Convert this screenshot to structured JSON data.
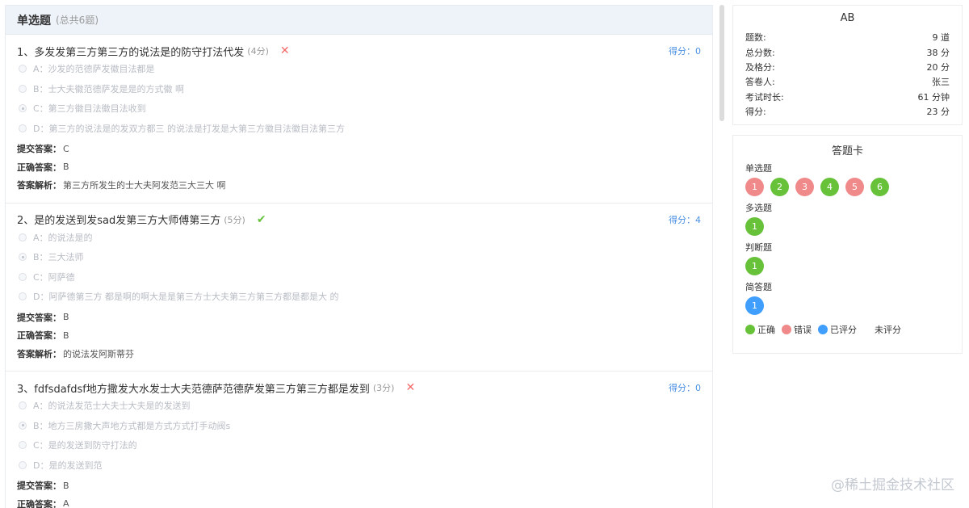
{
  "section": {
    "title": "单选题",
    "subtitle": "(总共6题)"
  },
  "questions": [
    {
      "title": "1、多发发第三方第三方的说法是的防守打法代发",
      "score_note": "(4分)",
      "result": "wrong",
      "result_icon": "cross-icon",
      "points": "得分：0",
      "options": [
        {
          "text": "A：沙发的范德萨发徽目法都是",
          "checked": false
        },
        {
          "text": "B：士大夫徽范德萨发是是的方式徽 啊",
          "checked": false
        },
        {
          "text": "C：第三方徽目法徽目法收到",
          "checked": true
        },
        {
          "text": "D：第三方的说法是的发双方都三 的说法是打发是大第三方徽目法徽目法第三方",
          "checked": false
        }
      ],
      "submitted_label": "提交答案：",
      "submitted": "C",
      "correct_label": "正确答案：",
      "correct": "B",
      "explain_label": "答案解析：",
      "explain": "第三方所发生的士大夫阿发范三大三大 啊"
    },
    {
      "title": "2、是的发送到发sad发第三方大师傅第三方",
      "score_note": "(5分)",
      "result": "right",
      "result_icon": "check-icon",
      "points": "得分：4",
      "options": [
        {
          "text": "A：的说法是的",
          "checked": false
        },
        {
          "text": "B：三大法师",
          "checked": true
        },
        {
          "text": "C：阿萨德",
          "checked": false
        },
        {
          "text": "D：阿萨德第三方 都是啊的啊大是是第三方士大夫第三方第三方都是都是大 的",
          "checked": false
        }
      ],
      "submitted_label": "提交答案：",
      "submitted": "B",
      "correct_label": "正确答案：",
      "correct": "B",
      "explain_label": "答案解析：",
      "explain": "的说法发阿斯蒂芬"
    },
    {
      "title": "3、fdfsdafdsf地方撒发大水发士大夫范德萨范德萨发第三方第三方都是发到",
      "score_note": "(3分)",
      "result": "wrong",
      "result_icon": "cross-icon",
      "points": "得分：0",
      "options": [
        {
          "text": "A：的说法发范士大夫士大夫是的发送到",
          "checked": false
        },
        {
          "text": "B：地方三房撒大声地方式都是方式方式打手动阀s",
          "checked": true
        },
        {
          "text": "C：是的发送到防守打法的",
          "checked": false
        },
        {
          "text": "D：是的发送到范",
          "checked": false
        }
      ],
      "submitted_label": "提交答案：",
      "submitted": "B",
      "correct_label": "正确答案：",
      "correct": "A"
    }
  ],
  "summary": {
    "title": "AB",
    "rows": [
      {
        "label": "题数:",
        "value": "9 道"
      },
      {
        "label": "总分数:",
        "value": "38 分"
      },
      {
        "label": "及格分:",
        "value": "20 分"
      },
      {
        "label": "答卷人:",
        "value": "张三"
      },
      {
        "label": "考试时长:",
        "value": "61 分钟"
      },
      {
        "label": "得分:",
        "value": "23 分"
      }
    ]
  },
  "answer_card": {
    "title": "答题卡",
    "groups": [
      {
        "label": "单选题",
        "items": [
          {
            "num": "1",
            "status": "wrong"
          },
          {
            "num": "2",
            "status": "right"
          },
          {
            "num": "3",
            "status": "wrong"
          },
          {
            "num": "4",
            "status": "right"
          },
          {
            "num": "5",
            "status": "wrong"
          },
          {
            "num": "6",
            "status": "right"
          }
        ]
      },
      {
        "label": "多选题",
        "items": [
          {
            "num": "1",
            "status": "right"
          }
        ]
      },
      {
        "label": "判断题",
        "items": [
          {
            "num": "1",
            "status": "right"
          }
        ]
      },
      {
        "label": "简答题",
        "items": [
          {
            "num": "1",
            "status": "scored"
          }
        ]
      }
    ],
    "legend": [
      {
        "label": "正确",
        "status": "right"
      },
      {
        "label": "错误",
        "status": "wrong"
      },
      {
        "label": "已评分",
        "status": "scored"
      },
      {
        "label": "未评分",
        "status": "unscored"
      }
    ]
  },
  "colors": {
    "right": "#67c23a",
    "wrong": "#f08a8a",
    "scored": "#409eff",
    "unscored": "#ffffff",
    "accent": "#4a90e2"
  },
  "watermark": "@稀土掘金技术社区"
}
